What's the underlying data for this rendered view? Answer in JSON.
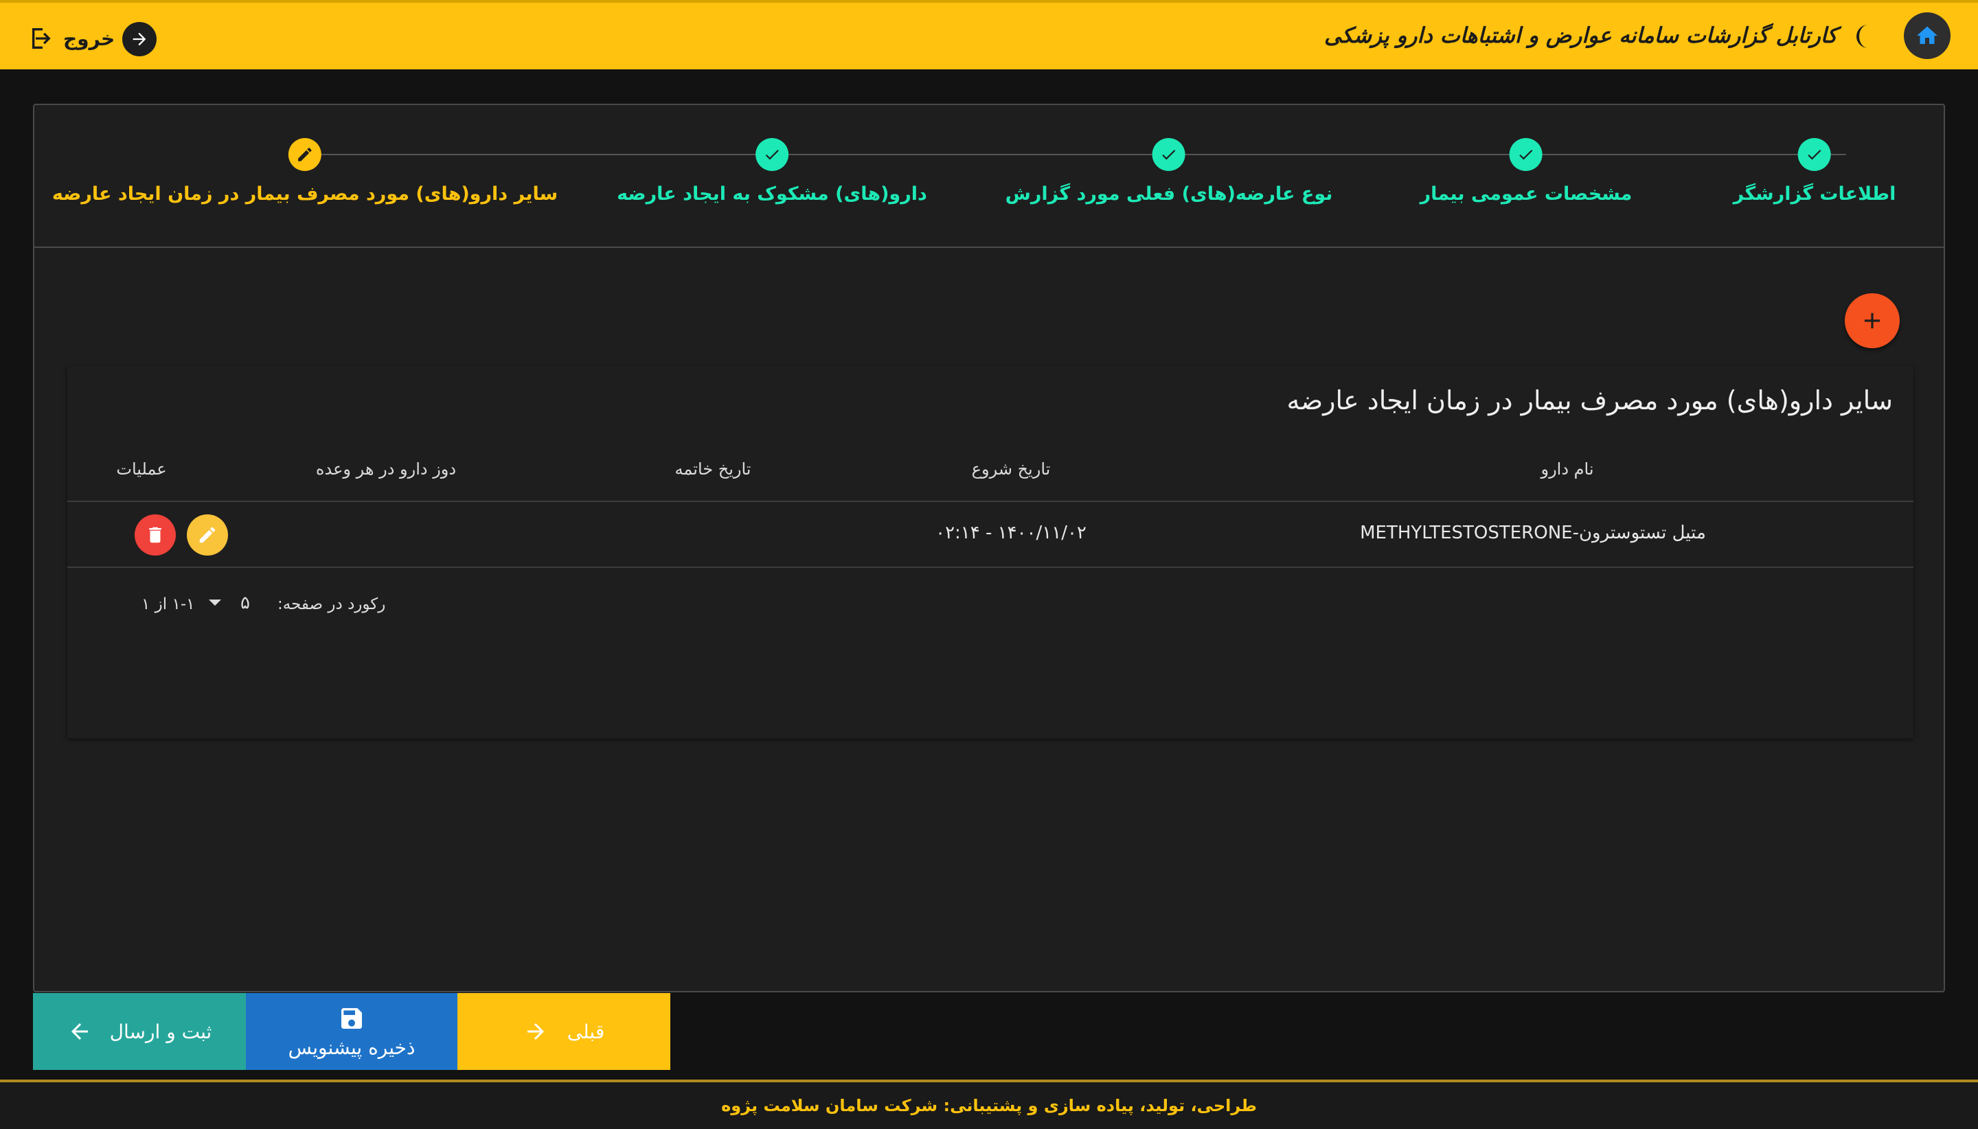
{
  "header": {
    "title": "کارتابل گزارشات سامانه عوارض و اشتباهات دارو پزشکی",
    "logout_label": "خروج",
    "home_icon": "home-icon",
    "theme_icon": "moon-icon"
  },
  "stepper": {
    "steps": [
      {
        "label": "اطلاعات گزارشگر",
        "status": "done"
      },
      {
        "label": "مشخصات عمومی بیمار",
        "status": "done"
      },
      {
        "label": "نوع عارضه(های) فعلی مورد گزارش",
        "status": "done"
      },
      {
        "label": "دارو(های) مشکوک به ایجاد عارضه",
        "status": "done"
      },
      {
        "label": "سایر دارو(های) مورد مصرف بیمار در زمان ایجاد عارضه",
        "status": "active"
      }
    ]
  },
  "table": {
    "title": "سایر دارو(های) مورد مصرف بیمار در زمان ایجاد عارضه",
    "columns": {
      "drug_name": "نام دارو",
      "start_date": "تاریخ شروع",
      "end_date": "تاریخ خاتمه",
      "dose": "دوز دارو در هر وعده",
      "actions": "عملیات"
    },
    "rows": [
      {
        "drug_name": "متیل تستوسترون-METHYLTESTOSTERONE",
        "start_date": "۱۴۰۰/۱۱/۰۲ - ۰۲:۱۴",
        "end_date": "",
        "dose": ""
      }
    ],
    "pagination": {
      "rows_per_page_label": "رکورد در صفحه:",
      "rows_per_page": "۵",
      "range": "۱-۱ از ۱"
    }
  },
  "actions": {
    "submit_label": "ثبت و ارسال",
    "draft_label": "ذخیره پیشنویس",
    "prev_label": "قبلی"
  },
  "footer": {
    "text": "طراحی، تولید، پیاده سازی و پشتیبانی: شرکت سامان سلامت پژوه"
  },
  "colors": {
    "brand_yellow": "#ffc20e",
    "step_done": "#1de9b6",
    "fab": "#f4511e",
    "submit": "#26a69a",
    "draft": "#1e73c8",
    "delete": "#f0413a"
  }
}
